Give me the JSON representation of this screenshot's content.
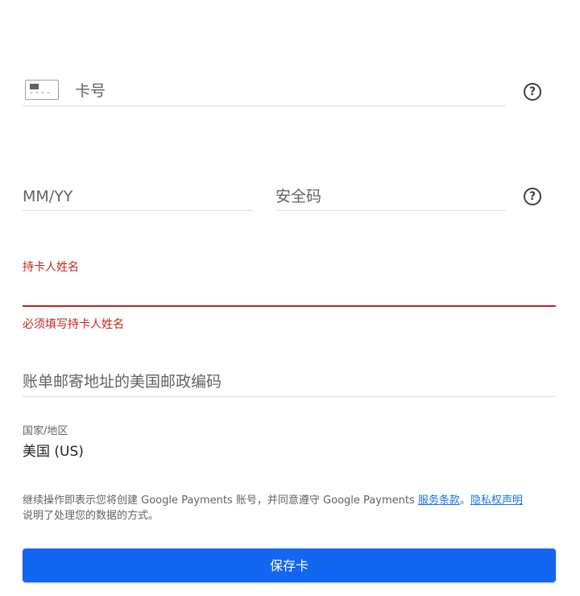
{
  "card_number": {
    "placeholder": "卡号",
    "icon": "credit-card-icon",
    "help_icon": "help-circle-icon",
    "icon_dashes": "----"
  },
  "expiry": {
    "placeholder": "MM/YY"
  },
  "cvc": {
    "placeholder": "安全码",
    "help_icon": "help-circle-icon"
  },
  "cardholder": {
    "label": "持卡人姓名",
    "value": "",
    "error": "必须填写持卡人姓名",
    "error_color": "#c5221f"
  },
  "zip": {
    "placeholder": "账单邮寄地址的美国邮政编码"
  },
  "country": {
    "label": "国家/地区",
    "value": "美国 (US)"
  },
  "terms": {
    "text_before": "继续操作即表示您将创建 Google Payments 账号，并同意遵守 Google Payments ",
    "terms_link": "服务条款",
    "separator": "。",
    "privacy_link": "隐私权声明",
    "text_after": "说明了处理您的数据的方式。",
    "link_color": "#1a73e8"
  },
  "save_button": {
    "label": "保存卡",
    "color": "#1266f1"
  }
}
